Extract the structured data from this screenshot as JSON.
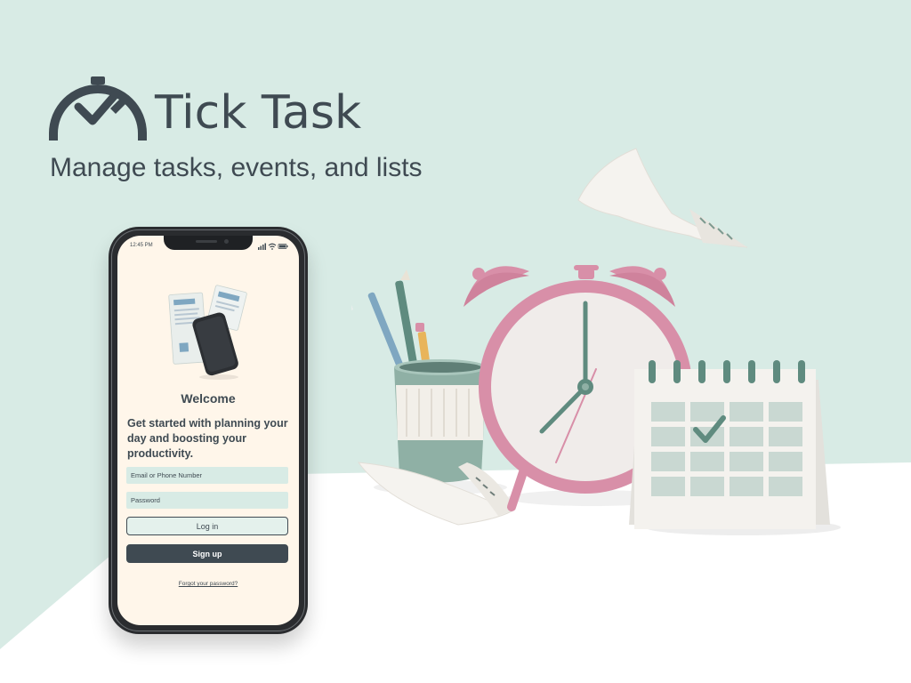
{
  "brand": {
    "name": "Tick Task",
    "tagline": "Manage tasks, events, and lists"
  },
  "phone": {
    "status_time": "12:45 PM",
    "welcome_title": "Welcome",
    "intro_text": "Get started with planning your day and boosting your productivity.",
    "email_placeholder": "Email or Phone Number",
    "password_placeholder": "Password",
    "login_label": "Log in",
    "signup_label": "Sign up",
    "forgot_label": "Forgot your password?"
  },
  "colors": {
    "background": "#d8ebe5",
    "table": "#ffffff",
    "brand_text": "#3f4a52",
    "phone_screen": "#fff6ea",
    "field_bg": "#d8ebe5",
    "primary_button": "#3f4a52",
    "clock_pink": "#d88fa8",
    "calendar_green": "#5f8b7f"
  },
  "icons": {
    "logo": "clock-check-icon",
    "status_bar": [
      "signal-icon",
      "wifi-icon",
      "battery-icon"
    ]
  }
}
